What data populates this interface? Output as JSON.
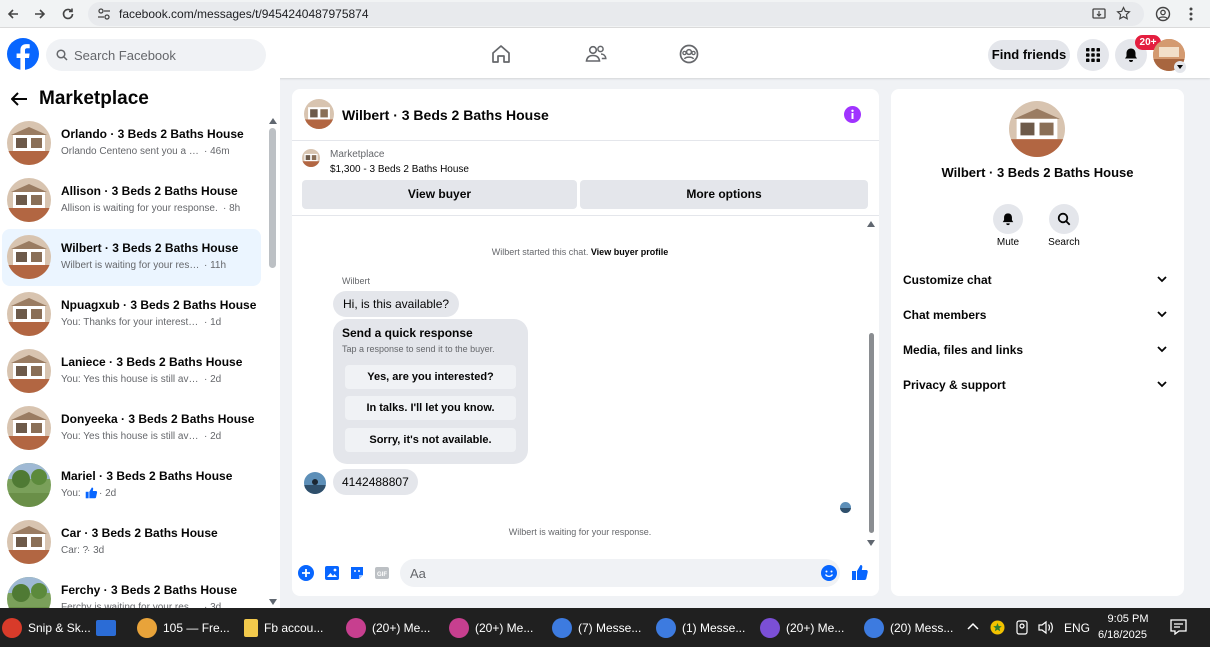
{
  "browser": {
    "url": "facebook.com/messages/t/9454240487975874"
  },
  "header": {
    "search_placeholder": "Search Facebook",
    "find_friends": "Find friends",
    "notif_count": "20+"
  },
  "left": {
    "title": "Marketplace",
    "conversations": [
      {
        "name": "Orlando · 3 Beds 2 Baths House",
        "preview": "Orlando Centeno sent you a mes...",
        "time": "· 46m"
      },
      {
        "name": "Allison · 3 Beds 2 Baths House",
        "preview": "Allison is waiting for your response.",
        "time": "· 8h"
      },
      {
        "name": "Wilbert · 3 Beds 2 Baths House",
        "preview": "Wilbert is waiting for your respon...",
        "time": "· 11h"
      },
      {
        "name": "Npuagxub · 3 Beds 2 Baths House",
        "preview": "You: Thanks for your interest in the ...",
        "time": "· 1d"
      },
      {
        "name": "Laniece · 3 Beds 2 Baths House",
        "preview": "You: Yes this house is still available ...",
        "time": "· 2d"
      },
      {
        "name": "Donyeeka · 3 Beds 2 Baths House",
        "preview": "You: Yes this house is still available ...",
        "time": "· 2d"
      },
      {
        "name": "Mariel · 3 Beds 2 Baths House",
        "preview": "You:",
        "time": "· 2d"
      },
      {
        "name": "Car · 3 Beds 2 Baths House",
        "preview": "Car: ?",
        "time": "· 3d"
      },
      {
        "name": "Ferchy · 3 Beds 2 Baths House",
        "preview": "Ferchy is waiting for your response",
        "time": "· 3d"
      }
    ]
  },
  "chat": {
    "title": "Wilbert · 3 Beds 2 Baths House",
    "listing_label": "Marketplace",
    "listing_price": "$1,300 - 3 Beds 2 Baths House",
    "view_buyer": "View buyer",
    "more_options": "More options",
    "started_text": "Wilbert started this chat.",
    "view_buyer_profile": "View buyer profile",
    "sender": "Wilbert",
    "buyer_message": "Hi, is this available?",
    "quick_title": "Send a quick response",
    "quick_sub": "Tap a response to send it to the buyer.",
    "quick_options": [
      "Yes, are you interested?",
      "In talks. I'll let you know.",
      "Sorry, it's not available."
    ],
    "phone_message": "4142488807",
    "waiting": "Wilbert is waiting for your response.",
    "composer_placeholder": "Aa"
  },
  "right": {
    "name": "Wilbert · 3 Beds 2 Baths House",
    "mute": "Mute",
    "search": "Search",
    "sections": [
      "Customize chat",
      "Chat members",
      "Media, files and links",
      "Privacy & support"
    ]
  },
  "taskbar": {
    "items": [
      "Snip & Sk...",
      "",
      "105 — Fre...",
      "Fb accou...",
      "(20+) Me...",
      "(20+) Me...",
      "(7) Messe...",
      "(1) Messe...",
      "(20+) Me...",
      "(20) Mess..."
    ],
    "lang": "ENG",
    "time": "9:05 PM",
    "date": "6/18/2025"
  },
  "colors": {
    "fb_blue": "#0866ff",
    "selected_bg": "#ebf5ff",
    "badge_red": "#e41e3f",
    "info_purple": "#a033ff"
  }
}
